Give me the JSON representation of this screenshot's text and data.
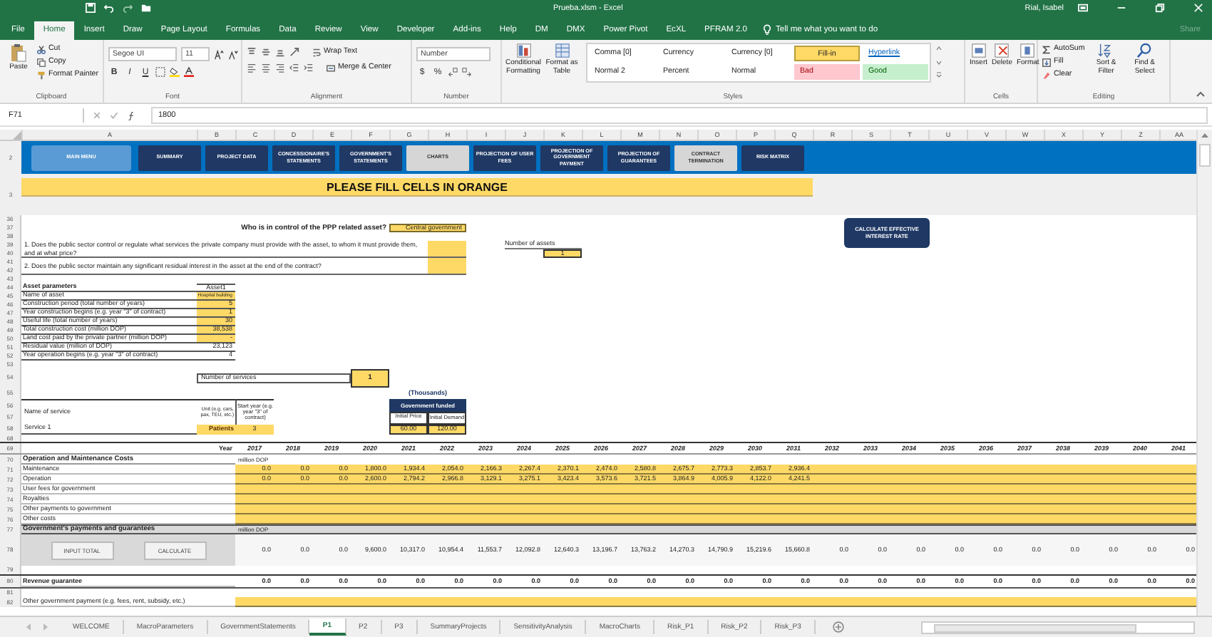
{
  "window": {
    "title": "Prueba.xlsm - Excel",
    "user": "Rial, Isabel"
  },
  "ribbon_tabs": [
    {
      "label": "File",
      "selected": false
    },
    {
      "label": "Home",
      "selected": true
    },
    {
      "label": "Insert",
      "selected": false
    },
    {
      "label": "Draw",
      "selected": false
    },
    {
      "label": "Page Layout",
      "selected": false
    },
    {
      "label": "Formulas",
      "selected": false
    },
    {
      "label": "Data",
      "selected": false
    },
    {
      "label": "Review",
      "selected": false
    },
    {
      "label": "View",
      "selected": false
    },
    {
      "label": "Developer",
      "selected": false
    },
    {
      "label": "Add-ins",
      "selected": false
    },
    {
      "label": "Help",
      "selected": false
    },
    {
      "label": "DM",
      "selected": false
    },
    {
      "label": "DMX",
      "selected": false
    },
    {
      "label": "Power Pivot",
      "selected": false
    },
    {
      "label": "EcXL",
      "selected": false
    },
    {
      "label": "PFRAM 2.0",
      "selected": false
    }
  ],
  "tell_me": "Tell me what you want to do",
  "share": "Share",
  "clipboard": {
    "paste": "Paste",
    "cut": "Cut",
    "copy": "Copy",
    "format_painter": "Format Painter",
    "label": "Clipboard"
  },
  "font": {
    "family": "Segoe UI",
    "size": "11",
    "bold": "B",
    "italic": "I",
    "underline": "U",
    "label": "Font"
  },
  "alignment": {
    "wrap": "Wrap Text",
    "merge": "Merge & Center",
    "label": "Alignment"
  },
  "number": {
    "format": "Number",
    "currency": "$",
    "percent": "%",
    "label": "Number"
  },
  "styles": {
    "conditional": "Conditional Formatting",
    "table": "Format as Table",
    "label": "Styles",
    "cell_styles": [
      {
        "label": "Comma [0]",
        "kind": "plain"
      },
      {
        "label": "Currency",
        "kind": "plain"
      },
      {
        "label": "Currency [0]",
        "kind": "plain"
      },
      {
        "label": "Fill-in",
        "kind": "fillin"
      },
      {
        "label": "Hyperlink",
        "kind": "link"
      },
      {
        "label": "Normal 2",
        "kind": "plain"
      },
      {
        "label": "Percent",
        "kind": "plain"
      },
      {
        "label": "Normal",
        "kind": "plain"
      },
      {
        "label": "Bad",
        "kind": "bad"
      },
      {
        "label": "Good",
        "kind": "good"
      }
    ]
  },
  "cells": {
    "insert": "Insert",
    "delete": "Delete",
    "format": "Format",
    "label": "Cells"
  },
  "editing": {
    "autosum": "AutoSum",
    "fill": "Fill",
    "clear": "Clear",
    "sort": "Sort & Filter",
    "find": "Find & Select",
    "label": "Editing"
  },
  "formula_bar": {
    "name_box": "F71",
    "value": "1800"
  },
  "columns": [
    "A",
    "B",
    "C",
    "D",
    "E",
    "F",
    "G",
    "H",
    "I",
    "J",
    "K",
    "L",
    "M",
    "N",
    "O",
    "P",
    "Q",
    "R",
    "S",
    "T",
    "U",
    "V",
    "W",
    "X",
    "Y",
    "Z",
    "AA"
  ],
  "nav_buttons": [
    {
      "label": "MAIN MENU",
      "kind": "main"
    },
    {
      "label": "SUMMARY",
      "kind": "nav"
    },
    {
      "label": "PROJECT DATA",
      "kind": "nav"
    },
    {
      "label": "CONCESSIONAIRE'S STATEMENTS",
      "kind": "nav"
    },
    {
      "label": "GOVERNMENT'S STATEMENTS",
      "kind": "nav"
    },
    {
      "label": "CHARTS",
      "kind": "grey"
    },
    {
      "label": "PROJECTION OF USER FEES",
      "kind": "nav"
    },
    {
      "label": "PROJECTION OF GOVERNMENT PAYMENT",
      "kind": "nav"
    },
    {
      "label": "PROJECTION OF GUARANTEES",
      "kind": "nav"
    },
    {
      "label": "CONTRACT TERMINATION",
      "kind": "grey"
    },
    {
      "label": "RISK MATRIX",
      "kind": "nav"
    }
  ],
  "nav_row": "2",
  "banner_row": "3",
  "banner": "PLEASE FILL CELLS IN ORANGE",
  "calc_button": "CALCULATE EFFECTIVE INTEREST RATE",
  "rows": [
    {
      "nums": [
        "36",
        "37",
        "38"
      ],
      "kind": "control",
      "question": "Who is in control of the PPP related asset?",
      "answer": "Central government"
    },
    {
      "nums": [
        "39",
        "40"
      ],
      "kind": "question",
      "text": "1. Does the public sector control or regulate what services the private company must provide with the asset, to whom it must provide them, and at what price?",
      "aside_label": "Number of assets",
      "aside_value": "1"
    },
    {
      "nums": [
        "41",
        "42"
      ],
      "kind": "question",
      "text": "2. Does the public sector maintain any significant residual interest in the asset at the end of the contract?"
    },
    {
      "nums": [
        "43"
      ],
      "kind": "blank"
    },
    {
      "nums": [
        "44"
      ],
      "kind": "asset_header",
      "label": "Asset parameters",
      "value": "Asset1"
    },
    {
      "nums": [
        "45"
      ],
      "kind": "param",
      "label": "Name of asset",
      "value": "Hospital building",
      "filled": true
    },
    {
      "nums": [
        "46"
      ],
      "kind": "param",
      "label": "Construction period (total number of years)",
      "value": "5",
      "filled": true
    },
    {
      "nums": [
        "47"
      ],
      "kind": "param",
      "label": "Year construction begins (e.g. year \"3\" of contract)",
      "value": "1",
      "filled": true
    },
    {
      "nums": [
        "48"
      ],
      "kind": "param",
      "label": "Useful life (total number of years)",
      "value": "30",
      "filled": true
    },
    {
      "nums": [
        "49"
      ],
      "kind": "param",
      "label": "Total construction cost (million DOP)",
      "value": "38,538",
      "filled": true
    },
    {
      "nums": [
        "50"
      ],
      "kind": "param",
      "label": "Land cost paid by the private partner (million DOP)",
      "value": "-",
      "filled": true
    },
    {
      "nums": [
        "51"
      ],
      "kind": "param",
      "label": "Residual value (million of DOP)",
      "value": "23,123",
      "filled": false
    },
    {
      "nums": [
        "52"
      ],
      "kind": "param",
      "label": "Year operation begins (e.g. year \"3\" of contract)",
      "value": "4",
      "filled": false
    },
    {
      "nums": [
        "53"
      ],
      "kind": "blank"
    },
    {
      "nums": [
        "54"
      ],
      "kind": "services_count",
      "label": "Number of services",
      "count": "1"
    },
    {
      "nums": [
        "55",
        "56",
        "57"
      ],
      "kind": "services_head",
      "thousands": "(Thousands)",
      "funded": "Government funded",
      "price": "Initial Price",
      "demand": "Initial Demand",
      "name": "Name of service",
      "unit": "Unit (e.g. cars, pax, TEU, etc.)",
      "start": "Start year (e.g. year \"3\" of contract)"
    },
    {
      "nums": [
        "58"
      ],
      "kind": "service",
      "name": "Service 1",
      "unit": "Patients",
      "start": "3",
      "price": "60.00",
      "demand": "120.00"
    },
    {
      "nums": [
        "68"
      ],
      "kind": "blank"
    },
    {
      "nums": [
        "69"
      ],
      "kind": "years",
      "label": "Year",
      "years": [
        "2017",
        "2018",
        "2019",
        "2020",
        "2021",
        "2022",
        "2023",
        "2024",
        "2025",
        "2026",
        "2027",
        "2028",
        "2029",
        "2030",
        "2031",
        "2032",
        "2033",
        "2034",
        "2035",
        "2036",
        "2037",
        "2038",
        "2039",
        "2040",
        "2041"
      ]
    },
    {
      "nums": [
        "70"
      ],
      "kind": "section",
      "label": "Operation and Maintenance Costs",
      "unit": "million DOP",
      "grey": false
    },
    {
      "nums": [
        "71"
      ],
      "kind": "values",
      "label": "Maintenance",
      "filled": true,
      "values": [
        "0.0",
        "0.0",
        "0.0",
        "1,800.0",
        "1,934.4",
        "2,054.0",
        "2,166.3",
        "2,267.4",
        "2,370.1",
        "2,474.0",
        "2,580.8",
        "2,675.7",
        "2,773.3",
        "2,853.7",
        "2,936.4"
      ]
    },
    {
      "nums": [
        "72"
      ],
      "kind": "values",
      "label": "Operation",
      "filled": true,
      "values": [
        "0.0",
        "0.0",
        "0.0",
        "2,600.0",
        "2,794.2",
        "2,966.8",
        "3,129.1",
        "3,275.1",
        "3,423.4",
        "3,573.6",
        "3,721.5",
        "3,864.9",
        "4,005.9",
        "4,122.0",
        "4,241.5"
      ]
    },
    {
      "nums": [
        "73"
      ],
      "kind": "values",
      "label": "User fees for government",
      "filled": true
    },
    {
      "nums": [
        "74"
      ],
      "kind": "values",
      "label": "Royalties",
      "filled": true
    },
    {
      "nums": [
        "75"
      ],
      "kind": "values",
      "label": "Other payments to government",
      "filled": true
    },
    {
      "nums": [
        "76"
      ],
      "kind": "values",
      "label": "Other costs",
      "filled": true
    },
    {
      "nums": [
        "77"
      ],
      "kind": "section",
      "label": "Government's payments and guarantees",
      "unit": "million DOP",
      "grey": true
    },
    {
      "nums": [
        "78"
      ],
      "kind": "totals",
      "buttons": [
        "INPUT TOTAL",
        "CALCULATE"
      ],
      "values": [
        "0.0",
        "0.0",
        "0.0",
        "9,600.0",
        "10,317.0",
        "10,954.4",
        "11,553.7",
        "12,092.8",
        "12,640.3",
        "13,196.7",
        "13,763.2",
        "14,270.3",
        "14,790.9",
        "15,219.6",
        "15,660.8",
        "0.0",
        "0.0",
        "0.0",
        "0.0",
        "0.0",
        "0.0",
        "0.0",
        "0.0",
        "0.0",
        "0.0"
      ]
    },
    {
      "nums": [
        "79"
      ],
      "kind": "blank"
    },
    {
      "nums": [
        "80"
      ],
      "kind": "bold_values",
      "label": "Revenue guarantee",
      "values": [
        "0.0",
        "0.0",
        "0.0",
        "0.0",
        "0.0",
        "0.0",
        "0.0",
        "0.0",
        "0.0",
        "0.0",
        "0.0",
        "0.0",
        "0.0",
        "0.0",
        "0.0",
        "0.0",
        "0.0",
        "0.0",
        "0.0",
        "0.0",
        "0.0",
        "0.0",
        "0.0",
        "0.0",
        "0.0"
      ]
    },
    {
      "nums": [
        "81"
      ],
      "kind": "blank"
    },
    {
      "nums": [
        "82"
      ],
      "kind": "values",
      "label": "Other government payment (e.g. fees, rent, subsidy, etc.)",
      "filled": true
    }
  ],
  "sheet_tabs": [
    {
      "label": "WELCOME",
      "selected": false
    },
    {
      "label": "MacroParameters",
      "selected": false
    },
    {
      "label": "GovernmentStatements",
      "selected": false
    },
    {
      "label": "P1",
      "selected": true
    },
    {
      "label": "P2",
      "selected": false
    },
    {
      "label": "P3",
      "selected": false
    },
    {
      "label": "SummaryProjects",
      "selected": false
    },
    {
      "label": "SensitivityAnalysis",
      "selected": false
    },
    {
      "label": "MacroCharts",
      "selected": false
    },
    {
      "label": "Risk_P1",
      "selected": false
    },
    {
      "label": "Risk_P2",
      "selected": false
    },
    {
      "label": "Risk_P3",
      "selected": false
    }
  ]
}
